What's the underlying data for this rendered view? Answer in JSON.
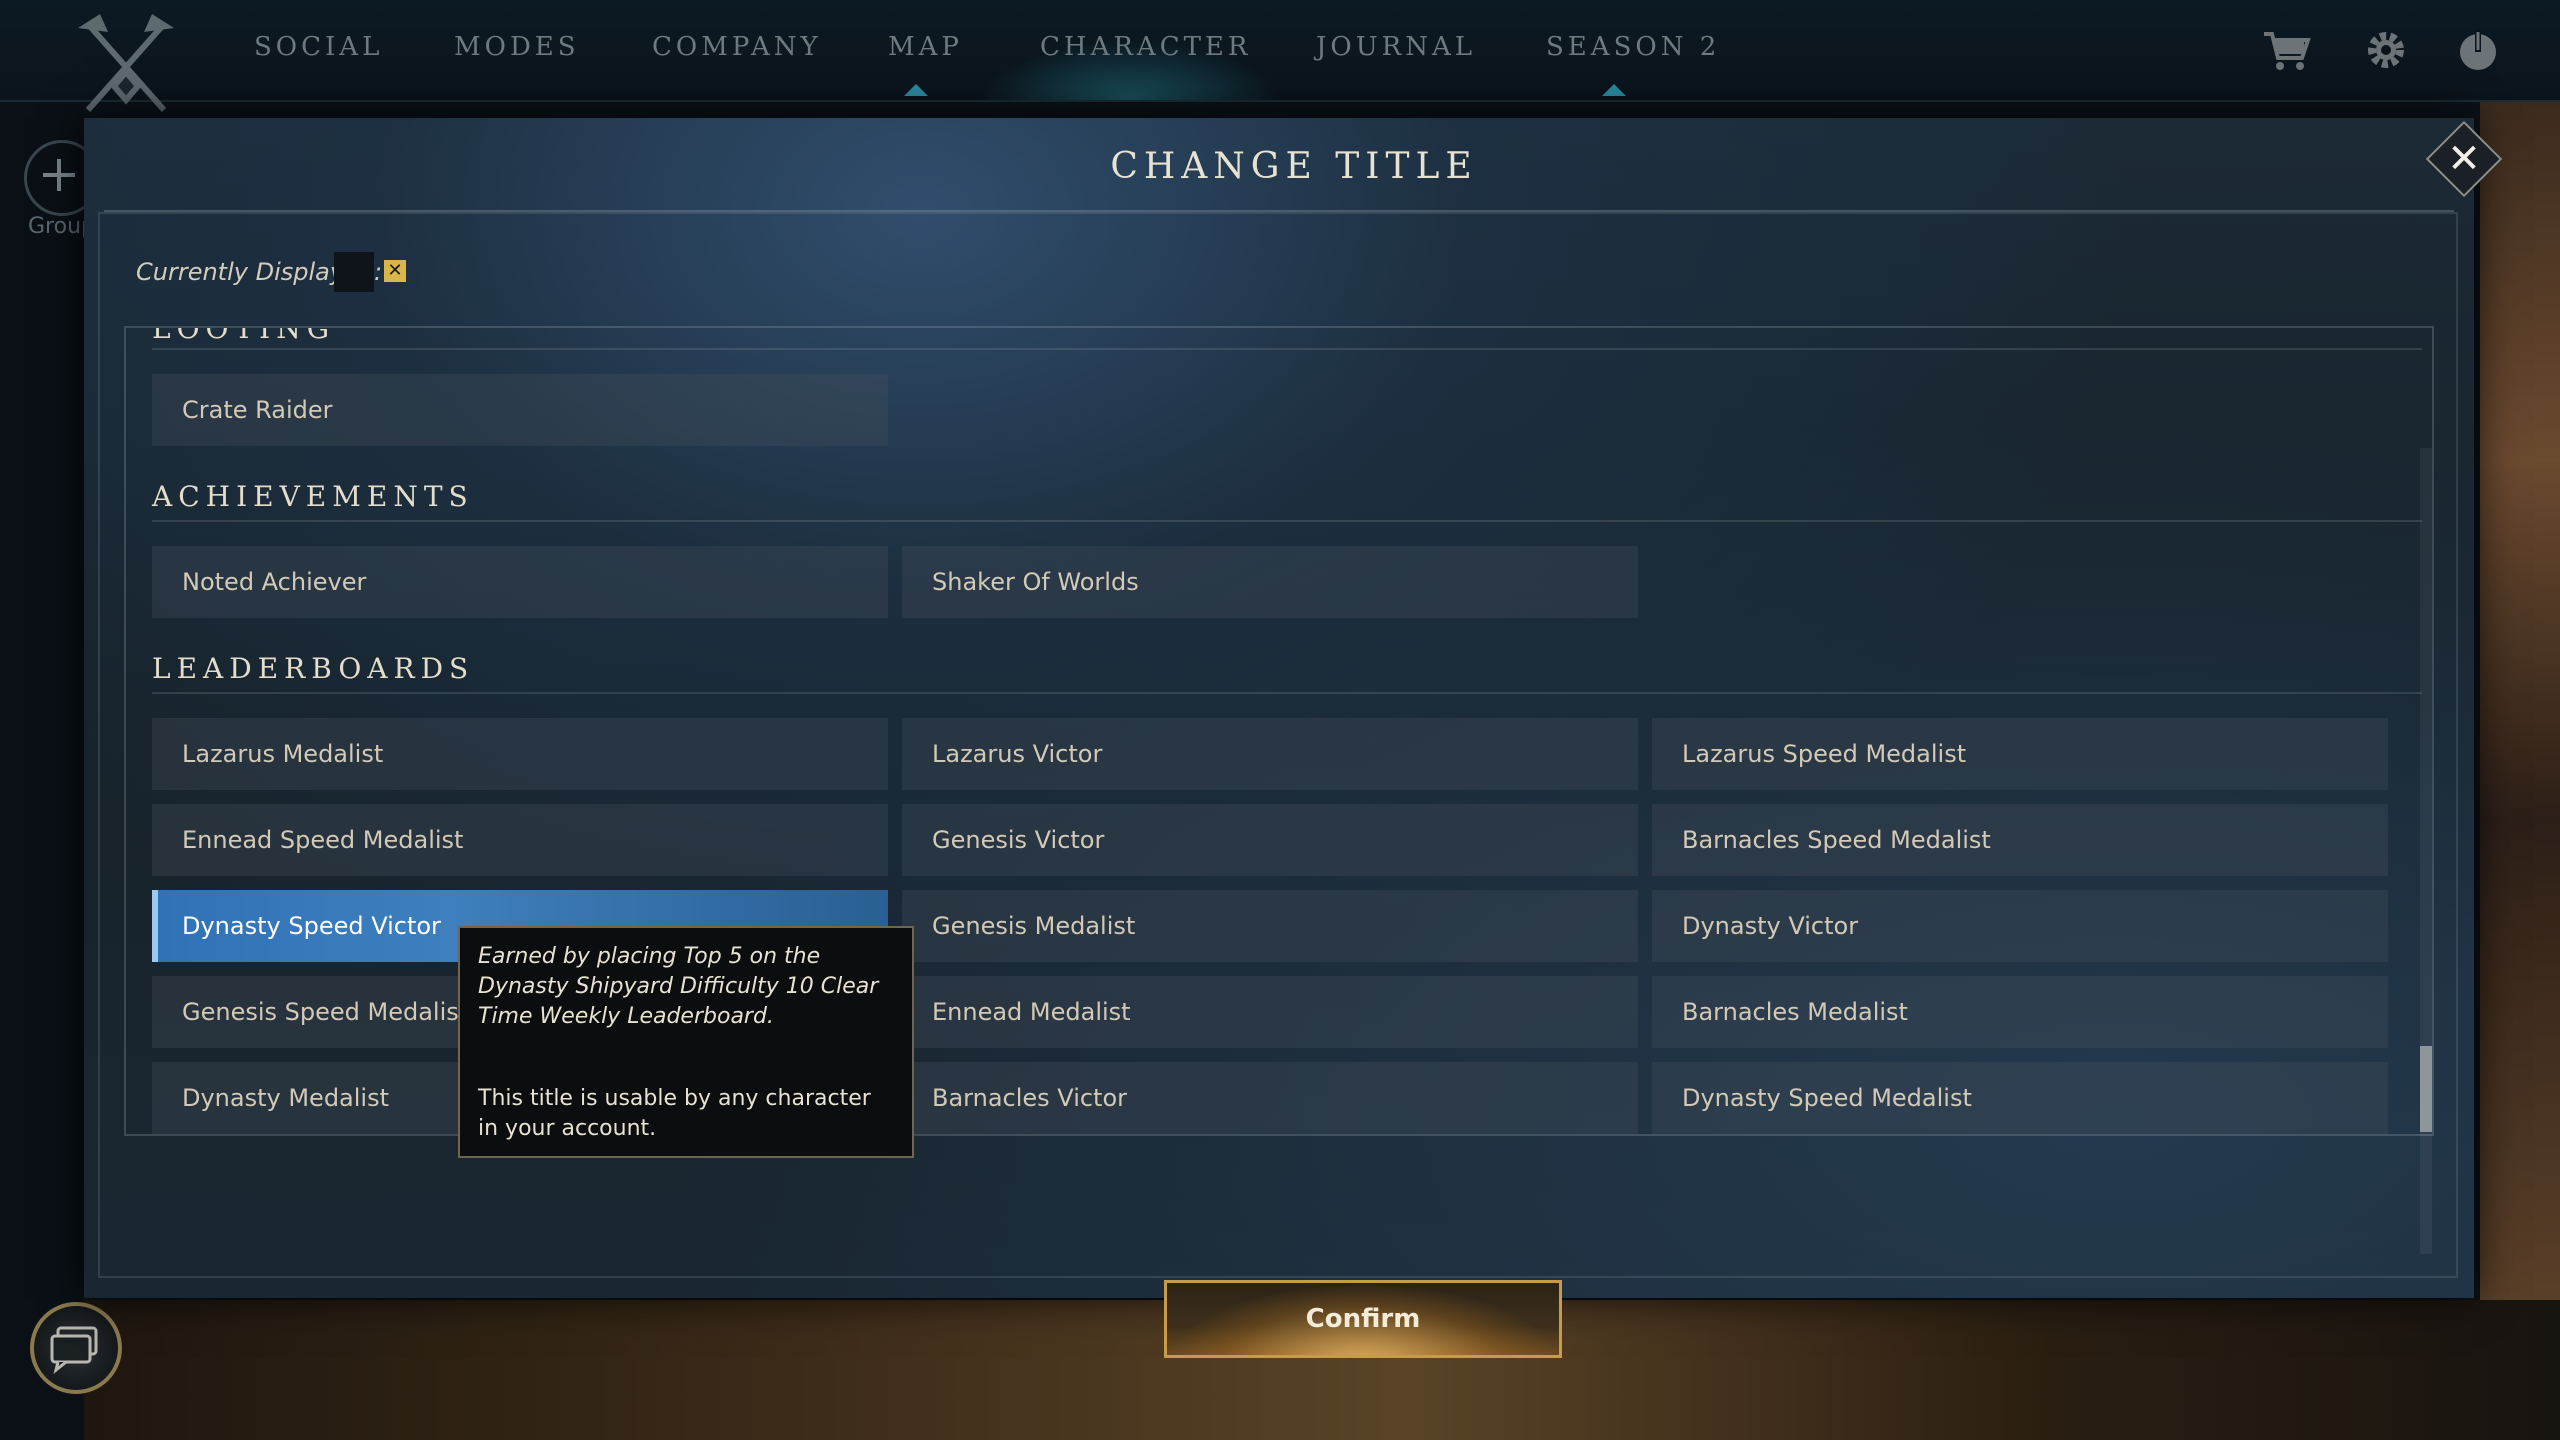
{
  "nav": {
    "items": [
      "SOCIAL",
      "MODES",
      "COMPANY",
      "MAP",
      "CHARACTER",
      "JOURNAL",
      "SEASON 2"
    ],
    "icons": [
      "cart-icon",
      "gear-icon",
      "power-icon"
    ]
  },
  "left_rail": {
    "group_label": "Group"
  },
  "modal": {
    "title": "CHANGE TITLE",
    "close_label": "✕",
    "currently_displayed_label": "Currently Displayed:",
    "clear_label": "✕",
    "confirm_label": "Confirm"
  },
  "sections": {
    "looting": {
      "title": "LOOTING",
      "items": [
        "Crate Raider"
      ]
    },
    "achievements": {
      "title": "ACHIEVEMENTS",
      "items": [
        "Noted Achiever",
        "Shaker Of Worlds"
      ]
    },
    "leaderboards": {
      "title": "LEADERBOARDS",
      "items": [
        "Lazarus Medalist",
        "Lazarus Victor",
        "Lazarus Speed Medalist",
        "Ennead Speed Medalist",
        "Genesis Victor",
        "Barnacles Speed Medalist",
        "Dynasty Speed Victor",
        "Genesis Medalist",
        "Dynasty Victor",
        "Genesis Speed Medalist",
        "Ennead Medalist",
        "Barnacles Medalist",
        "Dynasty Medalist",
        "Barnacles Victor",
        "Dynasty Speed Medalist"
      ]
    }
  },
  "selected_item": "Dynasty Speed Victor",
  "tooltip": {
    "description": "Earned by placing Top 5 on the Dynasty Shipyard Difficulty 10 Clear Time Weekly Leaderboard.",
    "note": "This title is usable by any character in your account."
  },
  "colors": {
    "selected": "#3e7fbd",
    "accent_gold": "#c79b4b",
    "nav_active": "#2b8aa0"
  }
}
